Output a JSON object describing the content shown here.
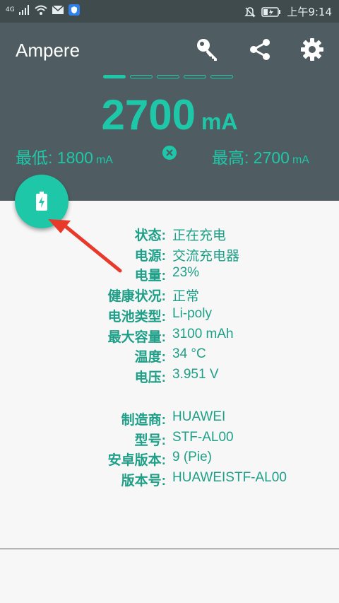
{
  "status_bar": {
    "network": "4G",
    "time": "上午9:14",
    "icons": [
      "signal-icon",
      "wifi-icon",
      "mail-icon",
      "shield-icon",
      "mute-icon",
      "battery-icon"
    ]
  },
  "app": {
    "title": "Ampere",
    "actions": [
      "key-icon",
      "share-icon",
      "settings-icon"
    ]
  },
  "pager": {
    "count": 5,
    "active_index": 0
  },
  "current": {
    "value": "2700",
    "unit": "mA"
  },
  "min": {
    "label": "最低: 1800",
    "unit": "mA"
  },
  "max": {
    "label": "最高: 2700",
    "unit": "mA"
  },
  "fab_icon": "battery-charging-icon",
  "details": [
    {
      "label": "状态:",
      "value": "正在充电"
    },
    {
      "label": "电源:",
      "value": "交流充电器"
    },
    {
      "label": "电量:",
      "value": "23%"
    },
    {
      "label": "健康状况:",
      "value": "正常"
    },
    {
      "label": "电池类型:",
      "value": "Li-poly"
    },
    {
      "label": "最大容量:",
      "value": "3100 mAh"
    },
    {
      "label": "温度:",
      "value": "34 °C"
    },
    {
      "label": "电压:",
      "value": "3.951 V"
    }
  ],
  "device": [
    {
      "label": "制造商:",
      "value": "HUAWEI"
    },
    {
      "label": "型号:",
      "value": "STF-AL00"
    },
    {
      "label": "安卓版本:",
      "value": "9 (Pie)"
    },
    {
      "label": "版本号:",
      "value": "HUAWEISTF-AL00"
    }
  ],
  "colors": {
    "accent": "#1ec7a8",
    "header": "#4f5d62",
    "statusbar": "#404b4e",
    "annotation": "#e8392b"
  }
}
